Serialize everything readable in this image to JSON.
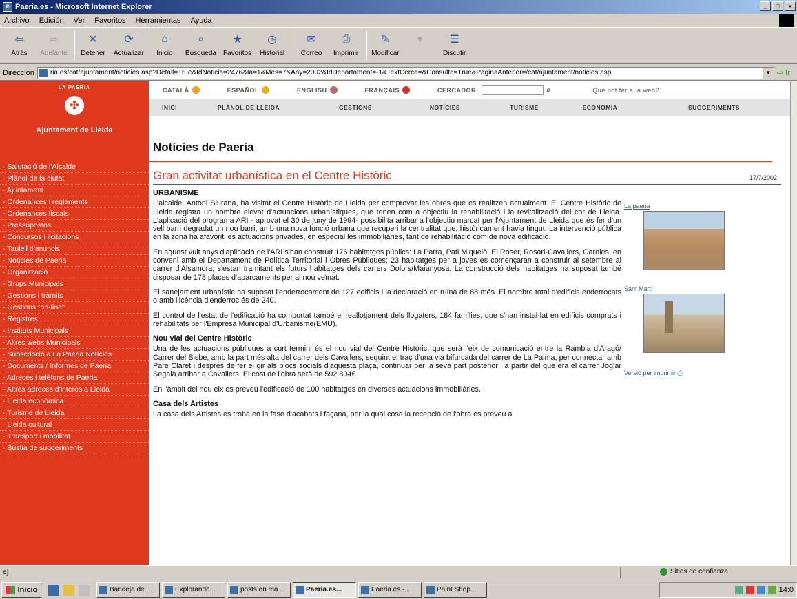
{
  "window": {
    "title": "Paeria.es - Microsoft Internet Explorer"
  },
  "menu": [
    "Archivo",
    "Edición",
    "Ver",
    "Favoritos",
    "Herramientas",
    "Ayuda"
  ],
  "toolbar": [
    {
      "label": "Atrás",
      "icon": "back-arrow-icon",
      "glyph": "⇦",
      "disabled": false
    },
    {
      "label": "Adelante",
      "icon": "forward-arrow-icon",
      "glyph": "⇨",
      "disabled": true
    },
    {
      "label": "Detener",
      "icon": "stop-icon",
      "glyph": "✕",
      "disabled": false
    },
    {
      "label": "Actualizar",
      "icon": "refresh-icon",
      "glyph": "⟳",
      "disabled": false
    },
    {
      "label": "Inicio",
      "icon": "home-icon",
      "glyph": "⌂",
      "disabled": false
    },
    {
      "label": "Búsqueda",
      "icon": "search-icon",
      "glyph": "⌕",
      "disabled": false
    },
    {
      "label": "Favoritos",
      "icon": "favorites-icon",
      "glyph": "★",
      "disabled": false
    },
    {
      "label": "Historial",
      "icon": "history-icon",
      "glyph": "◷",
      "disabled": false
    },
    {
      "label": "Correo",
      "icon": "mail-icon",
      "glyph": "✉",
      "disabled": false
    },
    {
      "label": "Imprimir",
      "icon": "print-icon",
      "glyph": "⎙",
      "disabled": false
    },
    {
      "label": "Modificar",
      "icon": "edit-icon",
      "glyph": "✎",
      "disabled": false
    },
    {
      "label": "",
      "icon": "discuss-dropdown-icon",
      "glyph": "▾",
      "disabled": true
    },
    {
      "label": "Discutir",
      "icon": "discuss-icon",
      "glyph": "☰",
      "disabled": false
    }
  ],
  "address": {
    "label": "Dirección",
    "url": "ria.es/cat/ajuntament/noticies.asp?Detall=True&IdNoticia=2476&Ia=1&Mes=7&Any=2002&IdDepartament=-1&TextCerca=&Consulta=True&PaginaAnterior=/cat/ajuntament/noticies.asp",
    "go_label": "Ir"
  },
  "site": {
    "logo_top": "LA PAERIA",
    "logo_name": "Ajuntament de Lleida",
    "langs": [
      {
        "label": "CATALÀ",
        "color": "#f0a020"
      },
      {
        "label": "ESPAÑOL",
        "color": "#e8b018"
      },
      {
        "label": "ENGLISH",
        "color": "#b07070"
      },
      {
        "label": "FRANÇAIS",
        "color": "#d03030"
      }
    ],
    "search_label": "CERCADOR",
    "help_link": "Què pot fer a la web?",
    "nav": [
      "INICI",
      "PLÀNOL DE LLEIDA",
      "GESTIONS",
      "NOTÍCIES",
      "TURISME",
      "ECONOMIA",
      "SUGGERIMENTS"
    ],
    "sidebar": [
      "· Salutació de l'Alcalde",
      "· Plànol de la ciutat",
      "· Ajuntament",
      "  - Ordenances i reglaments",
      "  - Ordenances fiscals",
      "  - Pressupostos",
      "  - Concursos i licitacions",
      "  - Taulell d'anuncis",
      "  - Notícies de Paeria",
      "  - Organització",
      "  - Grups Municipals",
      "  - Gestions i tràmits",
      "  - Gestions \"on-line\"",
      "  - Registres",
      "  - Instituts Municipals",
      "  - Altres webs Municipals",
      "  - Subscripció a La Paeria Notícies",
      "  - Documents / Informes de Paeria",
      "  - Adreces i telèfons de Paeria",
      "  - Altres adreces d'interès a Lleida",
      "· Lleida econòmica",
      "· Turisme de Lleida",
      "· Lleida cultural",
      "· Transport i mobilitat",
      "· Bústia de suggeriments"
    ],
    "page_title": "Notícies de Paeria",
    "article_title": "Gran activitat urbanística en el Centre Històric",
    "article_date": "17/7/2002",
    "section": "URBANISME",
    "paragraphs": [
      "L'alcalde, Antoni Siurana, ha visitat el Centre Històric de Lleida per comprovar les obres que es realitzen actualment. El Centre Històric de Lleida registra un nombre elevat d'actuacions urbanístiques, que tenen com a objectiu la rehabilitació i la revitalització del cor de Lleida. L'aplicació del programa ARI - aprovat el 30 de juny de 1994- possibilita arribar a l'objectiu marcat per l'Ajuntament de Lleida que és fer d'un vell barri degradat un nou barri, amb una nova funció urbana que recuperi la centralitat que, històricament havia tingut. La intervenció pública en la zona ha afavorit les actuacions privades, en especial les immobiliàries, tant de rehabilitació com de nova edificació.",
      "En aquest vuit anys d'aplicació de l'ARI s'han construït 176 habitatges públics: La Parra, Pati Miquelò, El Roser, Rosari-Cavallers, Garoles, en conveni amb el Departament de Política Territorial i Obres Públiques; 23 habitatges per a joves es començaran a construir al setembre al carrer d'Alsamora; s'estan tramitant els futurs habitatges dels carrers Dolors/Maianyosa. La construcció dels habitatges ha suposat també disposar de 178 places d'aparcaments per al nou veïnat.",
      "El sanejament urbanístic ha suposat l'enderrocament de 127 edificis i la declaració en ruïna de 88 més. El nombre total d'edificis enderrocats o amb llicència d'enderroc és de 240.",
      "El control de l'estat de l'edificació ha comportat també el reallotjament dels llogaters, 184 famílies, que s'han instal·lat en edificis comprats i rehabilitats per l'Empresa Municipal d'Urbanisme(EMU)."
    ],
    "subheading1": "Nou vial del Centre Històric",
    "paragraphs2": [
      "Una de les actuacions públiques a curt termini és el nou vial del Centre Històric, que serà l'eix de comunicació entre la Rambla d'Aragó/ Carrer del Bisbe, amb la part més alta del carrer dels Cavallers, seguint el traç d'una via bifurcada del carrer de La Palma, per connectar amb Pare Claret i després de fer el gir als blocs socials d'aquesta plaça, continuar per la seva part posterior i a partir del que era el carrer Joglar Segalà arribar a Cavallers. El cost de l'obra serà de 592.804€.",
      "En l'àmbit del nou eix es preveu l'edificació de 100 habitatges en diverses actuacions immobiliàries."
    ],
    "subheading2": "Casa dels Artistes",
    "paragraphs3": [
      "La casa dels Artistes es troba en la fase d'acabats i façana, per la qual cosa la recepció de l'obra es preveu a"
    ],
    "photo_captions": [
      "La paeria",
      "Sant Martí"
    ],
    "print_link": "Versió per imprimir"
  },
  "status": {
    "left": "e]",
    "zone": "Sitios de confianza"
  },
  "taskbar": {
    "start": "Inicio",
    "tasks": [
      "Bandeja de...",
      "Explorando...",
      "posts en ma...",
      "Paeria.es...",
      "Paeria.es - ...",
      "Paint Shop..."
    ],
    "active_index": 3,
    "clock": "14:0"
  }
}
